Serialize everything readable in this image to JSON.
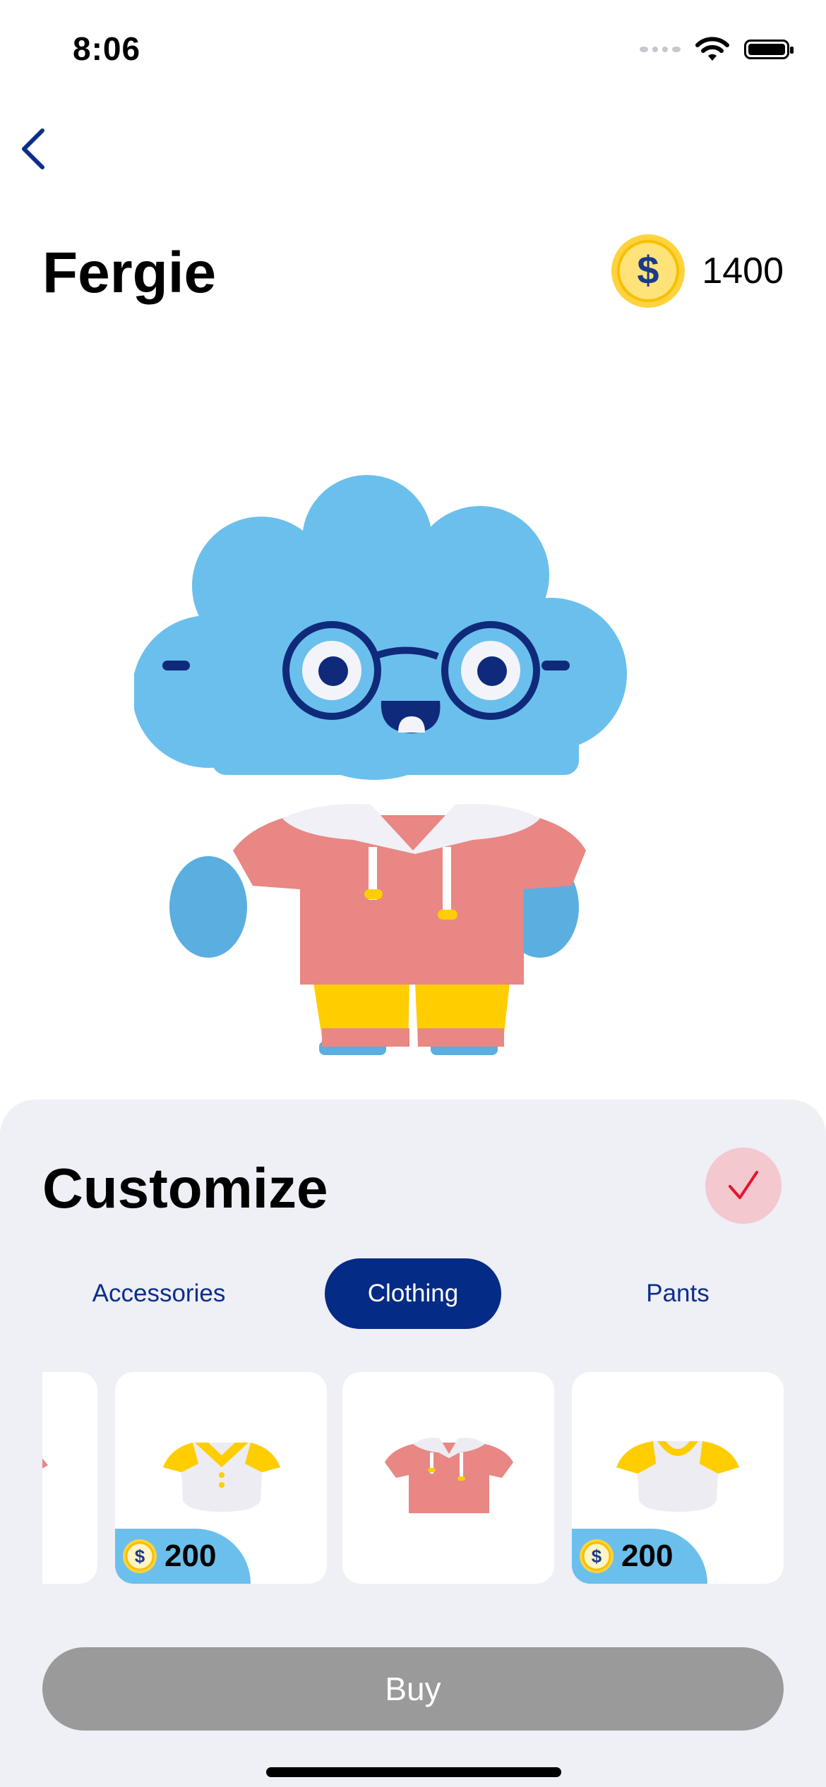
{
  "status_bar": {
    "time": "8:06"
  },
  "header": {
    "pet_name": "Fergie",
    "coin_balance": "1400"
  },
  "customize": {
    "title": "Customize",
    "tabs": [
      {
        "label": "Accessories",
        "active": false
      },
      {
        "label": "Clothing",
        "active": true
      },
      {
        "label": "Pants",
        "active": false
      }
    ],
    "items": [
      {
        "name": "partial-item",
        "price": null
      },
      {
        "name": "yellow-collar-shirt",
        "price": "200"
      },
      {
        "name": "pink-hoodie",
        "price": null
      },
      {
        "name": "white-yellow-tee",
        "price": "200"
      }
    ],
    "buy_label": "Buy"
  },
  "colors": {
    "accent_navy": "#042b86",
    "cloud_blue": "#6bbfec",
    "hoodie_pink": "#e88783",
    "coin_yellow": "#ffd33d",
    "buy_disabled": "#9a9a9a",
    "confirm_bg": "#f3c8cf"
  },
  "icons": [
    "back-chevron-icon",
    "coin-icon",
    "checkmark-icon",
    "wifi-icon",
    "battery-icon",
    "signal-icon"
  ]
}
